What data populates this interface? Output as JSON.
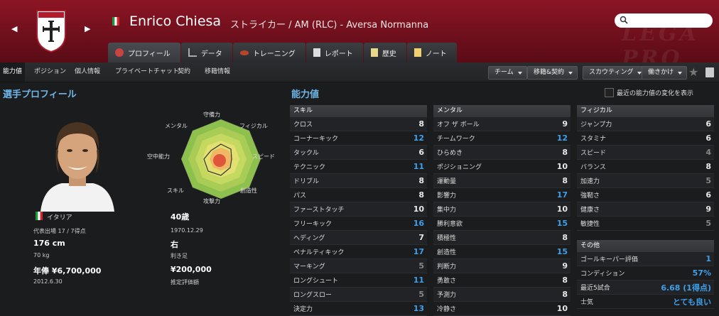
{
  "header": {
    "player_name": "Enrico Chiesa",
    "player_sub": "ストライカー / AM (RLC) - Aversa Normanna",
    "crest_text": "Aversa Normanna",
    "watermark": "LEGA PRO",
    "search_placeholder": ""
  },
  "tabs": [
    {
      "label": "プロフィール",
      "icon": "profile-icon"
    },
    {
      "label": "データ",
      "icon": "data-icon"
    },
    {
      "label": "トレーニング",
      "icon": "training-icon"
    },
    {
      "label": "レポート",
      "icon": "report-icon"
    },
    {
      "label": "歴史",
      "icon": "history-icon"
    },
    {
      "label": "ノート",
      "icon": "note-icon"
    }
  ],
  "subnav": {
    "items": [
      "能力値",
      "ポジション",
      "個人情報",
      "プライベートチャット",
      "契約",
      "移籍情報"
    ],
    "dropdowns": [
      "チーム",
      "移籍&契約",
      "スカウティング",
      "働きかけ"
    ]
  },
  "profile": {
    "title": "選手プロフィール",
    "radar_labels": [
      "守備力",
      "フィジカル",
      "スピード",
      "創造性",
      "攻撃力",
      "スキル",
      "空中能力",
      "メンタル"
    ],
    "nationality": "イタリア",
    "age": "40歳",
    "caps": "代表出場 17 / 7得点",
    "birth": "1970.12.29",
    "height": "176 cm",
    "foot": "右",
    "weight": "70 kg",
    "foot_label": "利き足",
    "wage": "年俸 ¥6,700,000",
    "value": "¥200,000",
    "contract": "2012.6.30",
    "value_label": "推定評価額"
  },
  "attributes": {
    "title": "能力値",
    "show_changes_label": "最近の能力値の変化を表示",
    "technical": {
      "header": "スキル",
      "rows": [
        {
          "name": "クロス",
          "value": "8",
          "color": "white"
        },
        {
          "name": "コーナーキック",
          "value": "12",
          "color": "blue"
        },
        {
          "name": "タックル",
          "value": "6",
          "color": "white"
        },
        {
          "name": "テクニック",
          "value": "11",
          "color": "blue"
        },
        {
          "name": "ドリブル",
          "value": "8",
          "color": "white"
        },
        {
          "name": "パス",
          "value": "8",
          "color": "white"
        },
        {
          "name": "ファーストタッチ",
          "value": "10",
          "color": "white"
        },
        {
          "name": "フリーキック",
          "value": "16",
          "color": "blue"
        },
        {
          "name": "ヘディング",
          "value": "7",
          "color": "white"
        },
        {
          "name": "ペナルティキック",
          "value": "17",
          "color": "blue"
        },
        {
          "name": "マーキング",
          "value": "5",
          "color": "gray"
        },
        {
          "name": "ロングシュート",
          "value": "11",
          "color": "blue"
        },
        {
          "name": "ロングスロー",
          "value": "5",
          "color": "gray"
        },
        {
          "name": "決定力",
          "value": "13",
          "color": "blue"
        }
      ]
    },
    "mental": {
      "header": "メンタル",
      "rows": [
        {
          "name": "オフ ザ ボール",
          "value": "9",
          "color": "white"
        },
        {
          "name": "チームワーク",
          "value": "12",
          "color": "blue"
        },
        {
          "name": "ひらめき",
          "value": "8",
          "color": "white"
        },
        {
          "name": "ポジショニング",
          "value": "10",
          "color": "white"
        },
        {
          "name": "運動量",
          "value": "8",
          "color": "white"
        },
        {
          "name": "影響力",
          "value": "17",
          "color": "blue"
        },
        {
          "name": "集中力",
          "value": "10",
          "color": "white"
        },
        {
          "name": "勝利意欲",
          "value": "15",
          "color": "blue"
        },
        {
          "name": "積極性",
          "value": "8",
          "color": "white"
        },
        {
          "name": "創造性",
          "value": "15",
          "color": "blue"
        },
        {
          "name": "判断力",
          "value": "9",
          "color": "white"
        },
        {
          "name": "勇敢さ",
          "value": "8",
          "color": "white"
        },
        {
          "name": "予測力",
          "value": "8",
          "color": "white"
        },
        {
          "name": "冷静さ",
          "value": "10",
          "color": "white"
        }
      ]
    },
    "physical": {
      "header": "フィジカル",
      "rows": [
        {
          "name": "ジャンプ力",
          "value": "6",
          "color": "white"
        },
        {
          "name": "スタミナ",
          "value": "6",
          "color": "white"
        },
        {
          "name": "スピード",
          "value": "4",
          "color": "gray"
        },
        {
          "name": "バランス",
          "value": "8",
          "color": "white"
        },
        {
          "name": "加速力",
          "value": "5",
          "color": "gray"
        },
        {
          "name": "強靭さ",
          "value": "6",
          "color": "white"
        },
        {
          "name": "健康さ",
          "value": "9",
          "color": "white"
        },
        {
          "name": "敏捷性",
          "value": "5",
          "color": "gray"
        }
      ]
    },
    "other": {
      "header": "その他",
      "rows": [
        {
          "name": "ゴールキーパー評価",
          "value": "1",
          "color": "blue"
        },
        {
          "name": "コンディション",
          "value": "57%",
          "color": "blue"
        },
        {
          "name": "最近5試合",
          "value": "6.68 (1得点)",
          "color": "blue"
        },
        {
          "name": "士気",
          "value": "とても良い",
          "color": "blue"
        }
      ]
    }
  }
}
